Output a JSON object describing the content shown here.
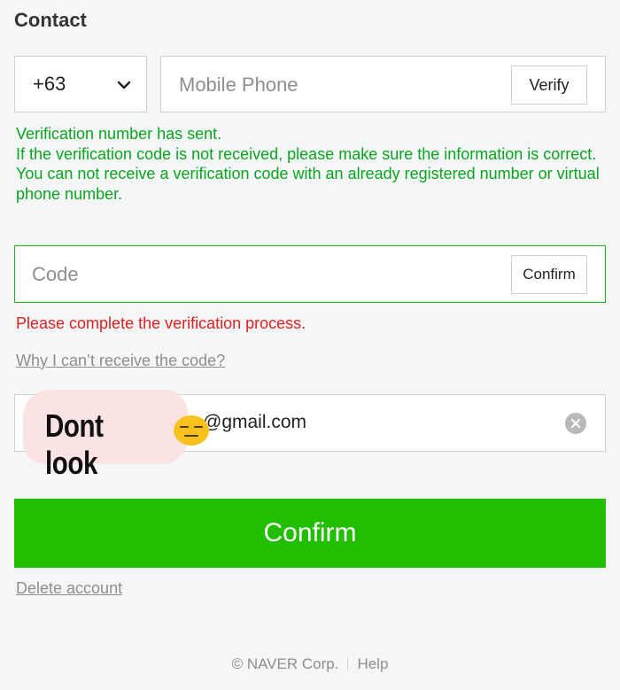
{
  "contact": {
    "title": "Contact"
  },
  "phone": {
    "country_code": "+63",
    "placeholder": "Mobile Phone",
    "verify_label": "Verify"
  },
  "messages": {
    "line1": "Verification number has sent.",
    "line2": "If the verification code is not received, please make sure the information is correct.",
    "line3": "You can not receive a verification code with an already registered number or virtual phone number.",
    "error": "Please complete the verification process."
  },
  "code": {
    "placeholder": "Code",
    "confirm_label": "Confirm"
  },
  "help_link": "Why I can’t receive the code?",
  "email": {
    "visible_value": "@gmail.com",
    "sticker_text": "Dont look"
  },
  "confirm_button": "Confirm",
  "delete_account": "Delete account",
  "footer": {
    "copyright": "© NAVER Corp.",
    "help": "Help"
  },
  "colors": {
    "brand_green": "#21bf00",
    "message_green": "#0aa51e",
    "error_red": "#e0201f"
  },
  "icons": [
    "chevron-down-icon",
    "clear-icon",
    "expressionless-emoji-icon"
  ]
}
